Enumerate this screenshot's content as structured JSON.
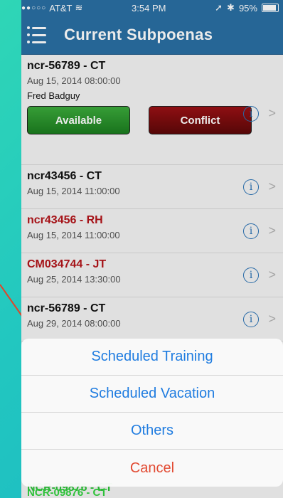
{
  "status": {
    "carrier": "AT&T",
    "signal": "●●○○○",
    "time": "3:54 PM",
    "battery": "95%"
  },
  "nav": {
    "title": "Current Subpoenas"
  },
  "items": [
    {
      "id": "ncr-56789 - CT",
      "date": "Aug 15, 2014 08:00:00",
      "person": "Fred Badguy",
      "red": false,
      "buttons": {
        "available": "Available",
        "conflict": "Conflict"
      }
    },
    {
      "id": "ncr43456 - CT",
      "date": "Aug 15, 2014 11:00:00",
      "red": false
    },
    {
      "id": "ncr43456 - RH",
      "date": "Aug 15, 2014 11:00:00",
      "red": true
    },
    {
      "id": "CM034744 - JT",
      "date": "Aug 25, 2014 13:30:00",
      "red": true
    },
    {
      "id": "ncr-56789 - CT",
      "date": "Aug 29, 2014 08:00:00",
      "red": false
    }
  ],
  "bottom_item": {
    "id": "NCR-09876 - CT"
  },
  "sheet": {
    "options": [
      "Scheduled Training",
      "Scheduled Vacation",
      "Others"
    ],
    "cancel": "Cancel"
  },
  "colors": {
    "navbar": "#2a6fa3",
    "link": "#1f7ce0",
    "cancel": "#e24b33",
    "alert_text": "#b3141a",
    "accent_green": "#2ec23a"
  }
}
